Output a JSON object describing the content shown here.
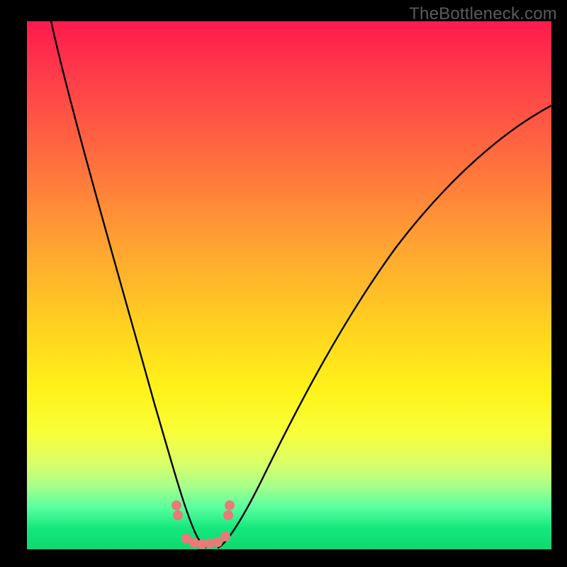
{
  "watermark": "TheBottleneck.com",
  "chart_data": {
    "type": "line",
    "title": "",
    "xlabel": "",
    "ylabel": "",
    "xlim": [
      0,
      100
    ],
    "ylim": [
      0,
      100
    ],
    "background_gradient": {
      "direction": "vertical",
      "stops": [
        {
          "pos": 0,
          "color": "#ff1a4d"
        },
        {
          "pos": 25,
          "color": "#ff6a3f"
        },
        {
          "pos": 58,
          "color": "#ffd21f"
        },
        {
          "pos": 78,
          "color": "#f8ff3a"
        },
        {
          "pos": 96,
          "color": "#14e87c"
        }
      ]
    },
    "series": [
      {
        "name": "left-branch",
        "x": [
          4,
          8,
          12,
          16,
          20,
          24,
          28,
          30,
          32,
          33
        ],
        "y": [
          100,
          82,
          66,
          52,
          39,
          27,
          16,
          10,
          5,
          2
        ]
      },
      {
        "name": "right-branch",
        "x": [
          37,
          40,
          45,
          50,
          56,
          63,
          71,
          80,
          90,
          100
        ],
        "y": [
          2,
          6,
          14,
          23,
          33,
          44,
          55,
          65,
          75,
          83
        ]
      }
    ],
    "markers": {
      "name": "highlight-dots",
      "x": [
        28,
        28.3,
        30,
        31.5,
        33,
        34.5,
        36,
        37.5,
        38,
        38.3
      ],
      "y": [
        9,
        7,
        2.2,
        1.4,
        1.2,
        1.3,
        1.6,
        2.6,
        7,
        9
      ],
      "color": "#e87a78"
    }
  }
}
